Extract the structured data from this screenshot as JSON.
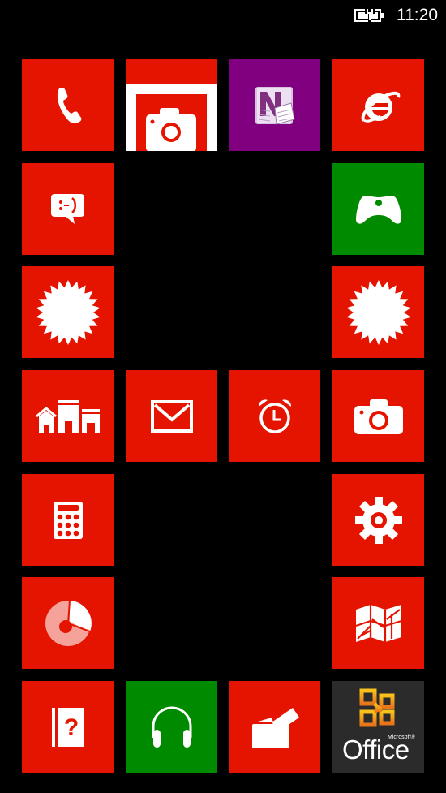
{
  "status_bar": {
    "time": "11:20",
    "battery_icon": "battery-charging-icon"
  },
  "colors": {
    "accent": "#e51400",
    "green": "#008a00",
    "purple": "#80007f",
    "office_bg": "#2b2b2b",
    "background": "#000000"
  },
  "tiles": [
    {
      "name": "phone",
      "icon": "phone-icon",
      "color": "#e51400"
    },
    {
      "name": "photos",
      "icon": "camera-photo-icon",
      "color": "#e51400"
    },
    {
      "name": "onenote",
      "icon": "onenote-icon",
      "color": "#80007f"
    },
    {
      "name": "internet-explorer",
      "icon": "ie-icon",
      "color": "#e51400"
    },
    {
      "name": "messaging",
      "icon": "message-smiley-icon",
      "color": "#e51400"
    },
    {
      "name": "games",
      "icon": "game-controller-icon",
      "color": "#008a00"
    },
    {
      "name": "app-left",
      "icon": "starburst-icon",
      "color": "#e51400"
    },
    {
      "name": "app-right",
      "icon": "starburst-icon",
      "color": "#e51400"
    },
    {
      "name": "store",
      "icon": "buildings-icon",
      "color": "#e51400"
    },
    {
      "name": "mail",
      "icon": "envelope-icon",
      "color": "#e51400"
    },
    {
      "name": "alarms",
      "icon": "alarm-clock-icon",
      "color": "#e51400"
    },
    {
      "name": "camera",
      "icon": "camera-icon",
      "color": "#e51400"
    },
    {
      "name": "calculator",
      "icon": "calculator-icon",
      "color": "#e51400"
    },
    {
      "name": "settings",
      "icon": "gear-icon",
      "color": "#e51400"
    },
    {
      "name": "data-sense",
      "icon": "pie-chart-icon",
      "color": "#e51400"
    },
    {
      "name": "maps",
      "icon": "map-icon",
      "color": "#e51400"
    },
    {
      "name": "help-tips",
      "icon": "help-book-icon",
      "color": "#e51400"
    },
    {
      "name": "music",
      "icon": "headphones-icon",
      "color": "#008a00"
    },
    {
      "name": "wallet",
      "icon": "wallet-cards-icon",
      "color": "#e51400"
    },
    {
      "name": "office",
      "icon": "office-logo-icon",
      "color": "#2b2b2b",
      "label": "Office",
      "sublabel": "Microsoft®"
    }
  ]
}
